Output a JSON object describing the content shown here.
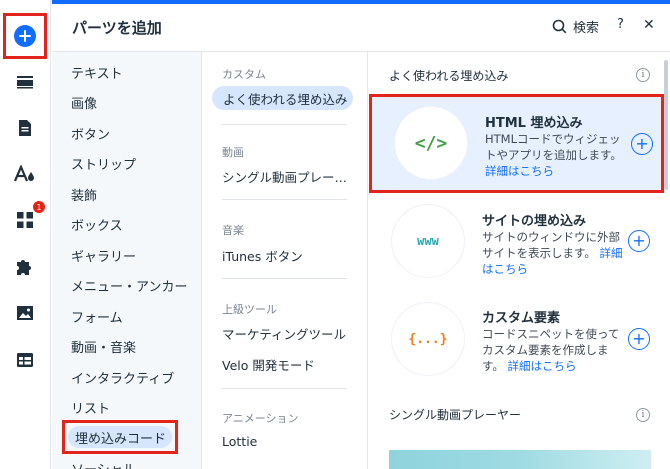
{
  "header": {
    "title": "パーツを追加",
    "search_label": "検索",
    "help_label": "?",
    "close_label": "✕"
  },
  "rail": {
    "apps_badge": "1"
  },
  "categories": [
    "テキスト",
    "画像",
    "ボタン",
    "ストリップ",
    "装飾",
    "ボックス",
    "ギャラリー",
    "メニュー・アンカー",
    "フォーム",
    "動画・音楽",
    "インタラクティブ",
    "リスト",
    "埋め込みコード",
    "ソーシャル"
  ],
  "subcategories": {
    "custom_heading": "カスタム",
    "custom_selected": "よく使われる埋め込み",
    "video_heading": "動画",
    "video_item": "シングル動画プレー…",
    "music_heading": "音楽",
    "music_item": "iTunes ボタン",
    "advanced_heading": "上級ツール",
    "advanced_item_1": "マーケティングツール",
    "advanced_item_2": "Velo 開発モード",
    "animation_heading": "アニメーション",
    "animation_item": "Lottie"
  },
  "content": {
    "section_title": "よく使われる埋め込み",
    "section2_title": "シングル動画プレーヤー",
    "cards": [
      {
        "title": "HTML 埋め込み",
        "desc": "HTMLコードでウィジェットやアプリを追加します。",
        "link": "詳細はこちら",
        "icon": "</>",
        "icon_color": "#43a047"
      },
      {
        "title": "サイトの埋め込み",
        "desc": "サイトのウィンドウに外部サイトを表示します。",
        "link": "詳細はこちら",
        "icon": "www",
        "icon_color": "#26a6b0"
      },
      {
        "title": "カスタム要素",
        "desc": "コードスニペットを使ってカスタム要素を作成します。",
        "link": "詳細はこちら",
        "icon": "{...}",
        "icon_color": "#f07c1a"
      }
    ]
  },
  "colors": {
    "accent": "#116dff",
    "highlight_border": "#e2241b"
  }
}
